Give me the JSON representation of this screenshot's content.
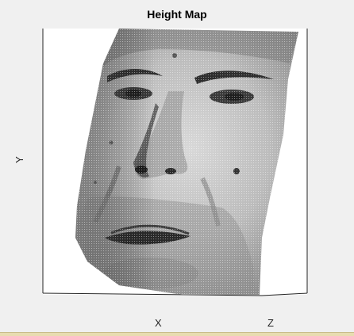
{
  "chart_data": {
    "type": "surface",
    "title": "Height Map",
    "axis_labels": {
      "x": "X",
      "y": "Y",
      "z": "Z"
    },
    "surface_subject": "3D face mesh rendered in grayscale",
    "view": "3-D view, surface rotated",
    "background": "#ffffff",
    "grid": false,
    "colormap": "gray"
  },
  "colors": {
    "figure_bg": "#f0f0f0",
    "axes_bg": "#ffffff",
    "axis_line": "#262626",
    "status_strip": "#e8dcb0"
  }
}
